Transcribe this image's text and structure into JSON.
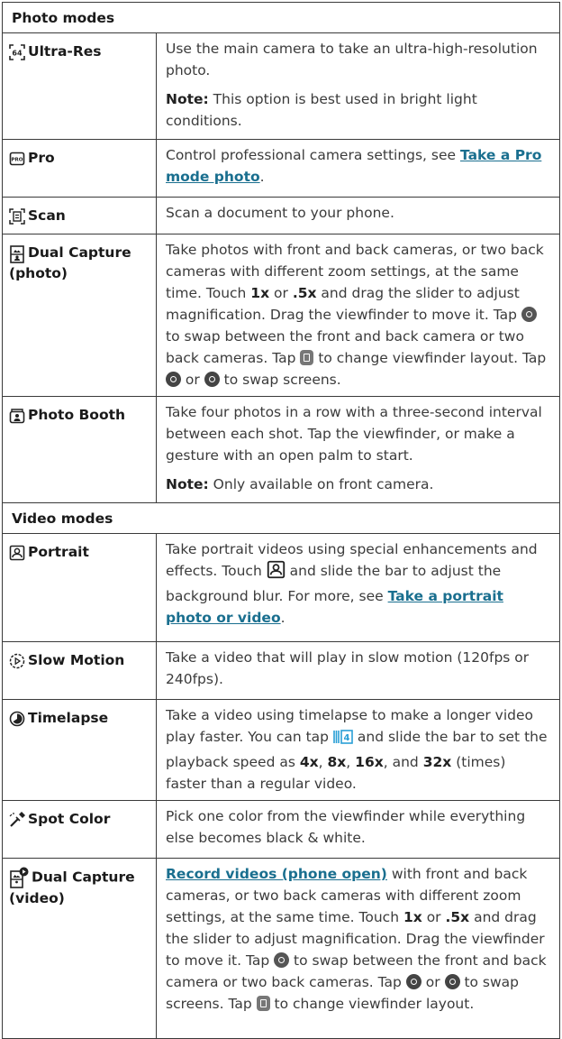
{
  "photo_header": "Photo modes",
  "video_header": "Video modes",
  "ultra_res": {
    "name": "Ultra-Res",
    "desc": "Use the main camera to take an ultra-high-resolution photo.",
    "note_label": "Note:",
    "note_text": " This option is best used in bright light conditions."
  },
  "pro": {
    "name": "Pro",
    "desc_before": "Control professional camera settings, see ",
    "link": "Take a Pro mode photo",
    "desc_after": "."
  },
  "scan": {
    "name": "Scan",
    "desc": "Scan a document to your phone."
  },
  "dual_photo": {
    "name": "Dual Capture (photo)",
    "t1": "Take photos with front and back cameras, or two back cameras with different zoom settings, at the same time. Touch ",
    "b1": "1x",
    "t2": " or ",
    "b2": ".5x",
    "t3": " and drag the slider to adjust magnification. Drag the viewfinder to move it. Tap ",
    "t4": " to swap between the front and back camera or two back cameras. Tap ",
    "t5": " to change viewfinder layout. Tap ",
    "t6": " or ",
    "t7": " to swap screens."
  },
  "photo_booth": {
    "name": "Photo Booth",
    "desc": "Take four photos in a row with a three-second interval between each shot. Tap the viewfinder, or make a gesture with an open palm to start.",
    "note_label": "Note:",
    "note_text": " Only available on front camera."
  },
  "portrait": {
    "name": "Portrait",
    "t1": "Take portrait videos using special enhancements and effects. Touch ",
    "t2": " and slide the bar to adjust the background blur. For more, see ",
    "link": "Take a portrait photo or video",
    "t3": "."
  },
  "slow_motion": {
    "name": "Slow Motion",
    "desc": "Take a video that will play in slow motion (120fps or 240fps)."
  },
  "timelapse": {
    "name": "Timelapse",
    "t1": "Take a video using timelapse to make a longer video play faster. You can tap ",
    "t2": " and slide the bar to set the playback speed as ",
    "b1": "4x",
    "s1": ", ",
    "b2": "8x",
    "s2": ", ",
    "b3": "16x",
    "s3": ", and ",
    "b4": "32x",
    "t3": " (times) faster than a regular video."
  },
  "spot_color": {
    "name": "Spot Color",
    "desc": "Pick one color from the viewfinder while everything else becomes black & white."
  },
  "dual_video": {
    "name": "Dual Capture (video)",
    "link": "Record videos (phone open)",
    "t1": " with front and back cameras, or two back cameras with different zoom settings, at the same time. Touch ",
    "b1": "1x",
    "t2": " or ",
    "b2": ".5x",
    "t3": " and drag the slider to adjust magnification. Drag the viewfinder to move it. Tap ",
    "t4": " to swap between the front and back camera or two back cameras. Tap ",
    "t5": " or ",
    "t6": " to swap screens. Tap ",
    "t7": " to change viewfinder layout."
  },
  "colors": {
    "link": "#1a6f8f",
    "border": "#3a3a3a",
    "text": "#333333"
  }
}
